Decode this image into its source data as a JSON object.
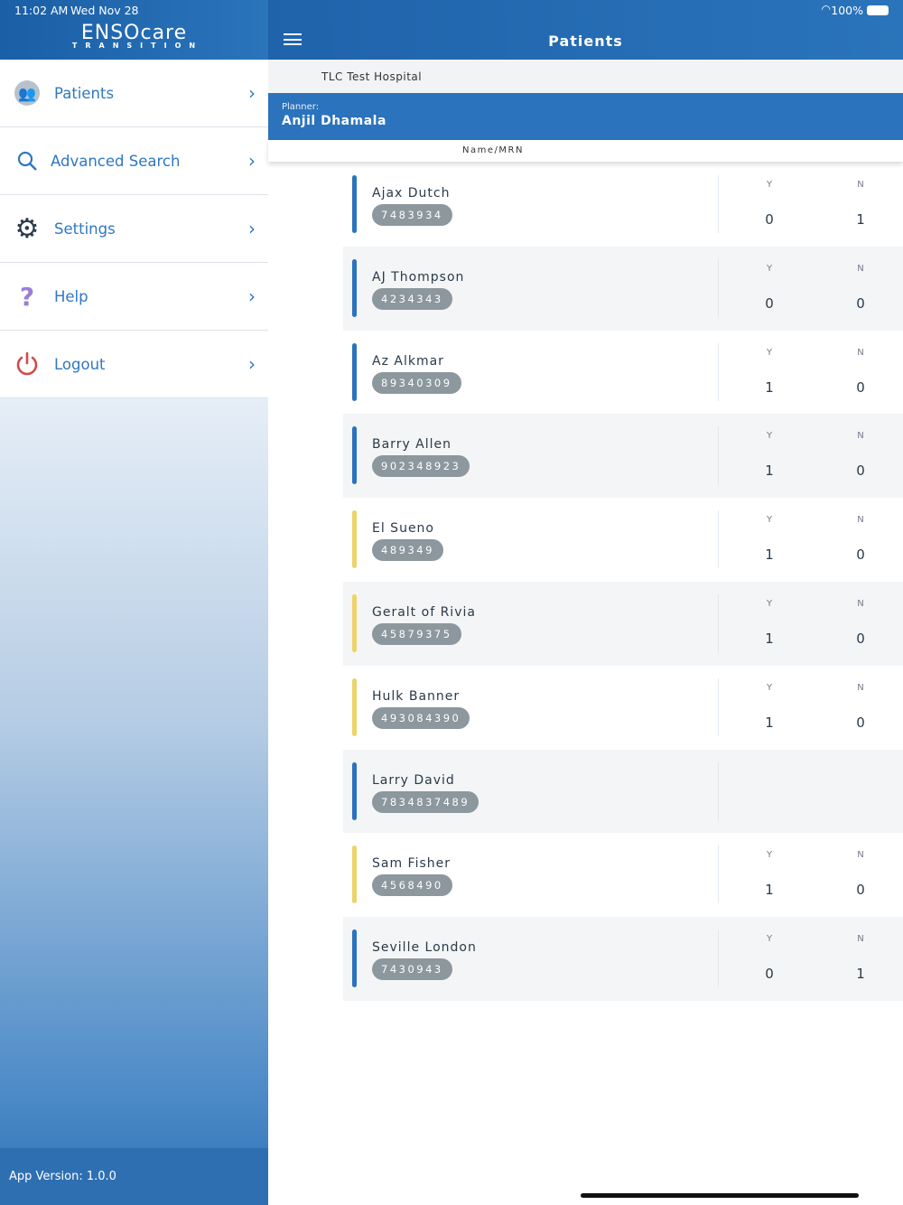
{
  "status": {
    "time": "11:02 AM",
    "date": "Wed Nov 28",
    "battery": "100%"
  },
  "logo": {
    "brand": "ENSOcare",
    "sub": "TRANSITION"
  },
  "sidebar": {
    "items": [
      {
        "label": "Patients",
        "icon": "patients-avatar-icon"
      },
      {
        "label": "Advanced Search",
        "icon": "search-icon"
      },
      {
        "label": "Settings",
        "icon": "gear-icon"
      },
      {
        "label": "Help",
        "icon": "question-icon"
      },
      {
        "label": "Logout",
        "icon": "power-icon"
      }
    ],
    "version": "App Version: 1.0.0"
  },
  "header": {
    "title": "Patients"
  },
  "hospital": "TLC Test Hospital",
  "planner": {
    "label": "Planner:",
    "name": "Anjil Dhamala"
  },
  "column_header": "Name/MRN",
  "colors": {
    "blue": "#2b73bc",
    "yellow": "#eed36a"
  },
  "patients": [
    {
      "name": "Ajax Dutch",
      "mrn": "7483934",
      "status": "blue",
      "y_label": "Y",
      "n_label": "N",
      "y": "0",
      "n": "1"
    },
    {
      "name": "AJ Thompson",
      "mrn": "4234343",
      "status": "blue",
      "y_label": "Y",
      "n_label": "N",
      "y": "0",
      "n": "0"
    },
    {
      "name": "Az Alkmar",
      "mrn": "89340309",
      "status": "blue",
      "y_label": "Y",
      "n_label": "N",
      "y": "1",
      "n": "0"
    },
    {
      "name": "Barry Allen",
      "mrn": "902348923",
      "status": "blue",
      "y_label": "Y",
      "n_label": "N",
      "y": "1",
      "n": "0"
    },
    {
      "name": "El Sueno",
      "mrn": "489349",
      "status": "yellow",
      "y_label": "Y",
      "n_label": "N",
      "y": "1",
      "n": "0"
    },
    {
      "name": "Geralt of Rivia",
      "mrn": "45879375",
      "status": "yellow",
      "y_label": "Y",
      "n_label": "N",
      "y": "1",
      "n": "0"
    },
    {
      "name": "Hulk Banner",
      "mrn": "493084390",
      "status": "yellow",
      "y_label": "Y",
      "n_label": "N",
      "y": "1",
      "n": "0"
    },
    {
      "name": "Larry David",
      "mrn": "7834837489",
      "status": "blue"
    },
    {
      "name": "Sam Fisher",
      "mrn": "4568490",
      "status": "yellow",
      "y_label": "Y",
      "n_label": "N",
      "y": "1",
      "n": "0"
    },
    {
      "name": "Seville London",
      "mrn": "7430943",
      "status": "blue",
      "y_label": "Y",
      "n_label": "N",
      "y": "0",
      "n": "1"
    }
  ]
}
